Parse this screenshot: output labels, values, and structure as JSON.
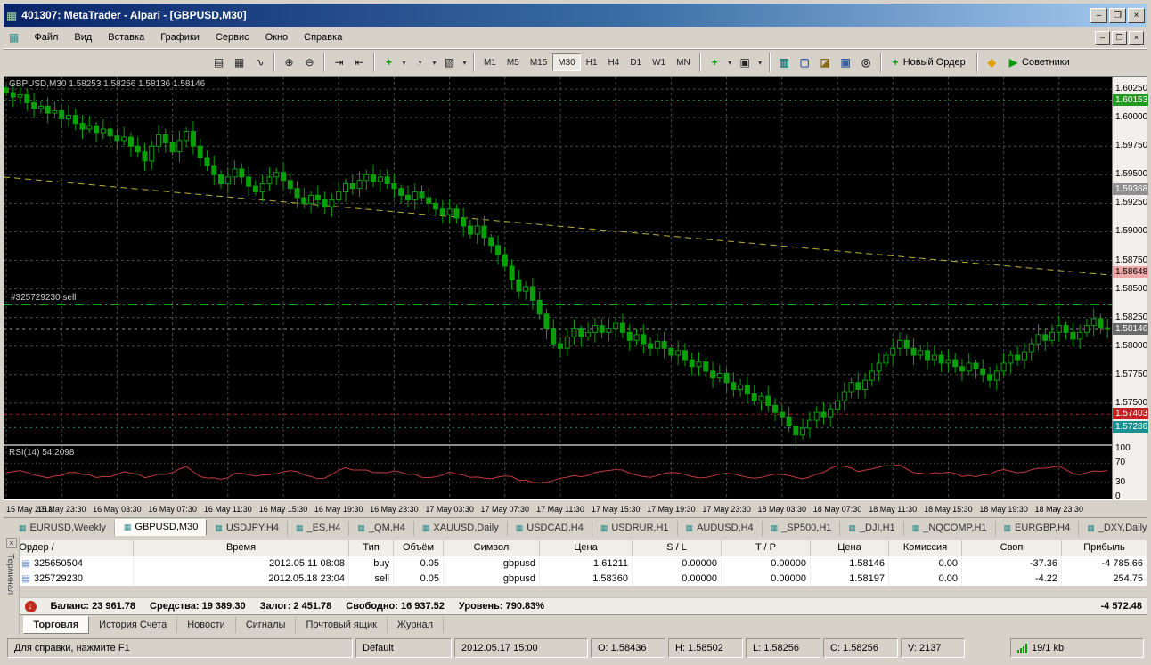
{
  "window": {
    "title": "401307: MetaTrader - Alpari - [GBPUSD,M30]",
    "minimize": "–",
    "restore": "❐",
    "close": "×",
    "app_icon_glyph": "▦"
  },
  "menu": {
    "items": [
      {
        "id": "file",
        "label": "Файл"
      },
      {
        "id": "view",
        "label": "Вид"
      },
      {
        "id": "insert",
        "label": "Вставка"
      },
      {
        "id": "charts",
        "label": "Графики"
      },
      {
        "id": "service",
        "label": "Сервис"
      },
      {
        "id": "window",
        "label": "Окно"
      },
      {
        "id": "help",
        "label": "Справка"
      }
    ],
    "chart_icon_glyph": "▦"
  },
  "toolbar": {
    "buttons": [
      {
        "id": "chart-bars",
        "glyph": "▤"
      },
      {
        "id": "chart-candles",
        "glyph": "▦"
      },
      {
        "id": "chart-line",
        "glyph": "∿"
      },
      {
        "sep": true
      },
      {
        "id": "zoom-in",
        "glyph": "⊕"
      },
      {
        "id": "zoom-out",
        "glyph": "⊖"
      },
      {
        "sep": true
      },
      {
        "id": "auto-scroll",
        "glyph": "⇥"
      },
      {
        "id": "chart-shift",
        "glyph": "⇤"
      },
      {
        "sep": true
      },
      {
        "id": "indicators",
        "glyph": "+",
        "color": "#0E9A0E",
        "dropdown": true
      },
      {
        "id": "periods",
        "glyph": "◔",
        "dropdown": true
      },
      {
        "id": "templates",
        "glyph": "▧",
        "dropdown": true
      },
      {
        "sep": true
      },
      {
        "tf": "M1"
      },
      {
        "tf": "M5"
      },
      {
        "tf": "M15"
      },
      {
        "tf": "M30",
        "pressed": true
      },
      {
        "tf": "H1"
      },
      {
        "tf": "H4"
      },
      {
        "tf": "D1"
      },
      {
        "tf": "W1"
      },
      {
        "tf": "MN"
      },
      {
        "sep": true
      },
      {
        "id": "new-chart",
        "glyph": "+",
        "color": "#0E9A0E",
        "dropdown": true
      },
      {
        "id": "profiles",
        "glyph": "▣",
        "dropdown": true
      },
      {
        "sep": true
      },
      {
        "id": "market-watch",
        "glyph": "▥",
        "color": "#1B7A7A"
      },
      {
        "id": "data-window",
        "glyph": "▢",
        "color": "#3A5FA0"
      },
      {
        "id": "navigator",
        "glyph": "◪",
        "color": "#8A6A1A"
      },
      {
        "id": "terminal-panel",
        "glyph": "▣",
        "color": "#3A5FA0"
      },
      {
        "id": "strategy-tester",
        "glyph": "◎",
        "color": "#333333"
      },
      {
        "sep": true
      },
      {
        "id": "new-order",
        "glyph": "+",
        "color": "#0E9A0E",
        "label": "Новый Ордер"
      },
      {
        "sep": true
      },
      {
        "id": "alerts",
        "glyph": "◆",
        "color": "#E0A000"
      },
      {
        "id": "experts",
        "glyph": "▶",
        "color": "#0E9A0E",
        "label": "Советники"
      }
    ]
  },
  "chart": {
    "header_label": "GBPUSD,M30 1.58253 1.58256 1.58136 1.58146",
    "order_label": "#325729230 sell",
    "rsi_label": "RSI(14) 54.2098"
  },
  "chart_data": {
    "type": "candlestick",
    "symbol": "GBPUSD",
    "timeframe": "M30",
    "current_bar": {
      "open": 1.58253,
      "high": 1.58256,
      "low": 1.58136,
      "close": 1.58146
    },
    "y_range": [
      1.5714,
      1.6036
    ],
    "y_ticks": [
      1.6025,
      1.6,
      1.5975,
      1.595,
      1.5925,
      1.59,
      1.5875,
      1.585,
      1.5825,
      1.58,
      1.5775,
      1.575
    ],
    "markers": [
      {
        "value": 1.60153,
        "color": "#229A22",
        "text": "#ffffff"
      },
      {
        "value": 1.59368,
        "color": "#909090",
        "text": "#ffffff"
      },
      {
        "value": 1.58648,
        "color": "#F0A8A8",
        "text": "#000000"
      },
      {
        "value": 1.58146,
        "color": "#6A6A6A",
        "text": "#ffffff"
      },
      {
        "value": 1.57403,
        "color": "#C22222",
        "text": "#ffffff"
      },
      {
        "value": 1.57286,
        "color": "#1A9090",
        "text": "#ffffff"
      }
    ],
    "h_lines": [
      {
        "id": "high-marker-line",
        "value": 1.60153,
        "color": "#1E8A1E",
        "dash": "2,4"
      },
      {
        "id": "order-sell-line",
        "value": 1.5836,
        "color": "#00B000",
        "dash": "10,4,2,4"
      },
      {
        "id": "bid-line",
        "value": 1.58146,
        "color": "#909090",
        "dash": "3,4"
      },
      {
        "id": "stop-line",
        "value": 1.57403,
        "color": "#B02020",
        "dash": "3,4"
      },
      {
        "id": "low-marker-line",
        "value": 1.57286,
        "color": "#1A9090",
        "dash": "2,4"
      }
    ],
    "trendline": {
      "from": 1.5948,
      "to": 1.5862,
      "color": "#BDB23B"
    },
    "candle_color": "#08A008",
    "x_labels": [
      "15 May 2012",
      "15 May 23:30",
      "16 May 03:30",
      "16 May 07:30",
      "16 May 11:30",
      "16 May 15:30",
      "16 May 19:30",
      "16 May 23:30",
      "17 May 03:30",
      "17 May 07:30",
      "17 May 11:30",
      "17 May 15:30",
      "17 May 19:30",
      "17 May 23:30",
      "18 May 03:30",
      "18 May 07:30",
      "18 May 11:30",
      "18 May 15:30",
      "18 May 19:30",
      "18 May 23:30"
    ],
    "bars_per_label": 8,
    "closes": [
      1.6022,
      1.6018,
      1.602,
      1.6013,
      1.6008,
      1.601,
      1.6004,
      1.6006,
      1.5999,
      1.6002,
      1.5995,
      1.599,
      1.5993,
      1.5987,
      1.599,
      1.5984,
      1.598,
      1.5983,
      1.5975,
      1.597,
      1.5962,
      1.5975,
      1.5985,
      1.5978,
      1.597,
      1.598,
      1.5988,
      1.5975,
      1.5965,
      1.5958,
      1.595,
      1.5942,
      1.5948,
      1.5955,
      1.5948,
      1.594,
      1.5935,
      1.5942,
      1.5948,
      1.5952,
      1.5945,
      1.5938,
      1.593,
      1.5925,
      1.5932,
      1.5928,
      1.5922,
      1.5928,
      1.5935,
      1.5942,
      1.5938,
      1.5945,
      1.595,
      1.5944,
      1.5948,
      1.5942,
      1.5938,
      1.5932,
      1.5928,
      1.5935,
      1.593,
      1.5925,
      1.592,
      1.5915,
      1.592,
      1.5912,
      1.5905,
      1.5898,
      1.5905,
      1.5895,
      1.5888,
      1.588,
      1.587,
      1.5858,
      1.5848,
      1.5852,
      1.584,
      1.5828,
      1.5815,
      1.5802,
      1.5798,
      1.5808,
      1.5815,
      1.5808,
      1.5812,
      1.5818,
      1.5812,
      1.5815,
      1.582,
      1.5812,
      1.5805,
      1.581,
      1.5802,
      1.5798,
      1.5804,
      1.5798,
      1.5792,
      1.5796,
      1.5788,
      1.5782,
      1.5786,
      1.5778,
      1.5772,
      1.5776,
      1.5768,
      1.5762,
      1.5766,
      1.5758,
      1.5752,
      1.5756,
      1.5748,
      1.5742,
      1.5738,
      1.573,
      1.5722,
      1.5728,
      1.5735,
      1.5742,
      1.5738,
      1.5745,
      1.5752,
      1.576,
      1.5768,
      1.5762,
      1.577,
      1.5778,
      1.5785,
      1.5792,
      1.5798,
      1.5805,
      1.5798,
      1.5792,
      1.5796,
      1.5788,
      1.5792,
      1.5785,
      1.5788,
      1.5782,
      1.5778,
      1.5785,
      1.578,
      1.5775,
      1.577,
      1.5778,
      1.5785,
      1.5792,
      1.5788,
      1.5795,
      1.5802,
      1.581,
      1.5805,
      1.5812,
      1.5818,
      1.5812,
      1.5806,
      1.5812,
      1.5818,
      1.5824,
      1.5816,
      1.58146
    ],
    "rsi": {
      "label": "RSI(14) 54.2098",
      "current": 54.2098,
      "levels": [
        100,
        70,
        30,
        0
      ],
      "color": "#C03A3A"
    }
  },
  "chart_tabs": {
    "icon_glyph": "▦",
    "items": [
      {
        "label": "EURUSD,Weekly"
      },
      {
        "label": "GBPUSD,M30",
        "active": true
      },
      {
        "label": "USDJPY,H4"
      },
      {
        "label": "_ES,H4"
      },
      {
        "label": "_QM,H4"
      },
      {
        "label": "XAUUSD,Daily"
      },
      {
        "label": "USDCAD,H4"
      },
      {
        "label": "USDRUR,H1"
      },
      {
        "label": "AUDUSD,H4"
      },
      {
        "label": "_SP500,H1"
      },
      {
        "label": "_DJI,H1"
      },
      {
        "label": "_NQCOMP,H1"
      },
      {
        "label": "EURGBP,H4"
      },
      {
        "label": "_DXY,Daily"
      }
    ]
  },
  "terminal": {
    "panel_label": "Терминал",
    "close_glyph": "×",
    "row_icon_glyph": "▤",
    "balance_icon_glyph": "↓",
    "headers": [
      "Ордер  /",
      "Время",
      "Тип",
      "Объём",
      "Символ",
      "Цена",
      "S / L",
      "T / P",
      "Цена",
      "Комиссия",
      "Своп",
      "Прибыль"
    ],
    "rows": [
      {
        "order": "325650504",
        "time": "2012.05.11 08:08",
        "type": "buy",
        "volume": "0.05",
        "symbol": "gbpusd",
        "price": "1.61211",
        "sl": "0.00000",
        "tp": "0.00000",
        "price2": "1.58146",
        "commission": "0.00",
        "swap": "-37.36",
        "profit": "-4 785.66"
      },
      {
        "order": "325729230",
        "time": "2012.05.18 23:04",
        "type": "sell",
        "volume": "0.05",
        "symbol": "gbpusd",
        "price": "1.58360",
        "sl": "0.00000",
        "tp": "0.00000",
        "price2": "1.58197",
        "commission": "0.00",
        "swap": "-4.22",
        "profit": "254.75"
      }
    ],
    "balance": {
      "segments": [
        "Баланс: 23 961.78",
        "Средства: 19 389.30",
        "Залог: 2 451.78",
        "Свободно: 16 937.52",
        "Уровень: 790.83%"
      ],
      "profit": "-4 572.48"
    },
    "tabs": [
      {
        "id": "trade",
        "label": "Торговля",
        "active": true
      },
      {
        "id": "account-history",
        "label": "История Счета"
      },
      {
        "id": "news",
        "label": "Новости"
      },
      {
        "id": "signals",
        "label": "Сигналы"
      },
      {
        "id": "mailbox",
        "label": "Почтовый ящик"
      },
      {
        "id": "journal",
        "label": "Журнал"
      }
    ]
  },
  "status_bar": {
    "help": "Для справки, нажмите F1",
    "profile": "Default",
    "time": "2012.05.17 15:00",
    "open": "O: 1.58436",
    "high": "H: 1.58502",
    "low": "L: 1.58256",
    "close": "C: 1.58256",
    "volume": "V: 2137",
    "traffic": "19/1 kb"
  }
}
